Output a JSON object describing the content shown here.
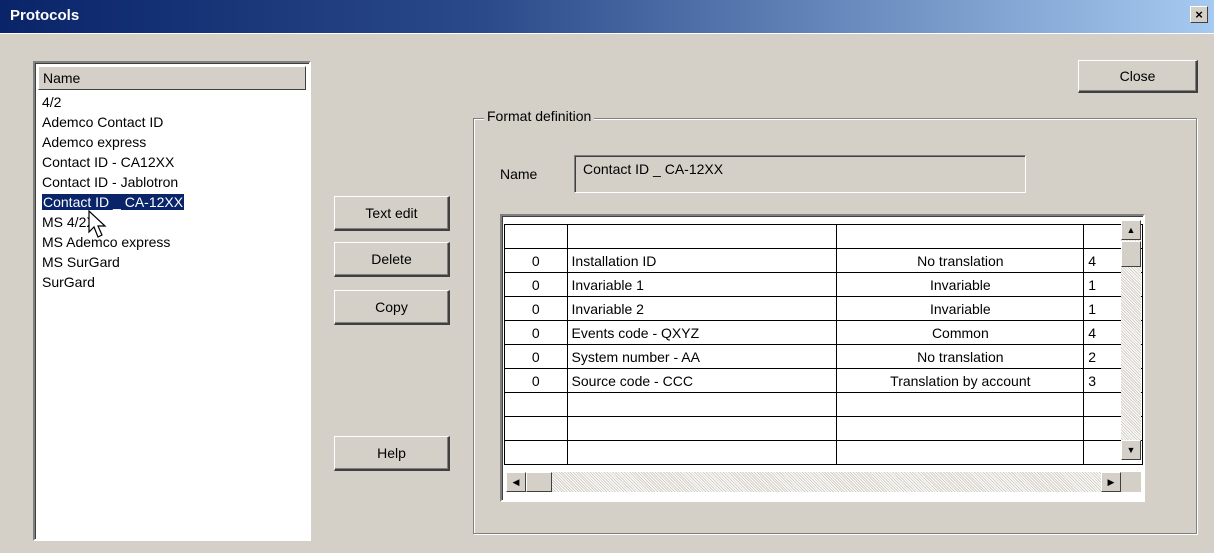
{
  "window": {
    "title": "Protocols",
    "close_glyph": "×",
    "close_icon": "close-icon"
  },
  "protocol_list": {
    "header": "Name",
    "items": [
      "4/2",
      "Ademco Contact ID",
      "Ademco express",
      "Contact ID - CA12XX",
      "Contact ID - Jablotron",
      "Contact ID _ CA-12XX",
      "MS 4/2X",
      "MS Ademco express",
      "MS SurGard",
      "SurGard"
    ],
    "selected": "Contact ID _ CA-12XX"
  },
  "buttons": {
    "close": "Close",
    "text_edit": "Text edit",
    "delete": "Delete",
    "copy": "Copy",
    "help": "Help"
  },
  "format_definition": {
    "legend": "Format definition",
    "name_label": "Name",
    "name_value": "Contact ID _ CA-12XX",
    "rows": [
      [
        "",
        "",
        "",
        ""
      ],
      [
        "0",
        "Installation ID",
        "No translation",
        "4"
      ],
      [
        "0",
        "Invariable 1",
        "Invariable",
        "1"
      ],
      [
        "0",
        "Invariable 2",
        "Invariable",
        "1"
      ],
      [
        "0",
        "Events code - QXYZ",
        "Common",
        "4"
      ],
      [
        "0",
        "System number - AA",
        "No translation",
        "2"
      ],
      [
        "0",
        "Source code - CCC",
        "Translation by account",
        "3"
      ],
      [
        "",
        "",
        "",
        ""
      ],
      [
        "",
        "",
        "",
        ""
      ],
      [
        "",
        "",
        "",
        ""
      ]
    ]
  },
  "scrollbar_glyphs": {
    "up": "▲",
    "down": "▼",
    "left": "◀",
    "right": "▶"
  },
  "colors": {
    "face": "#d4d0c8",
    "selection": "#0a246a",
    "title_start": "#0a246a",
    "title_end": "#a6caf0"
  }
}
